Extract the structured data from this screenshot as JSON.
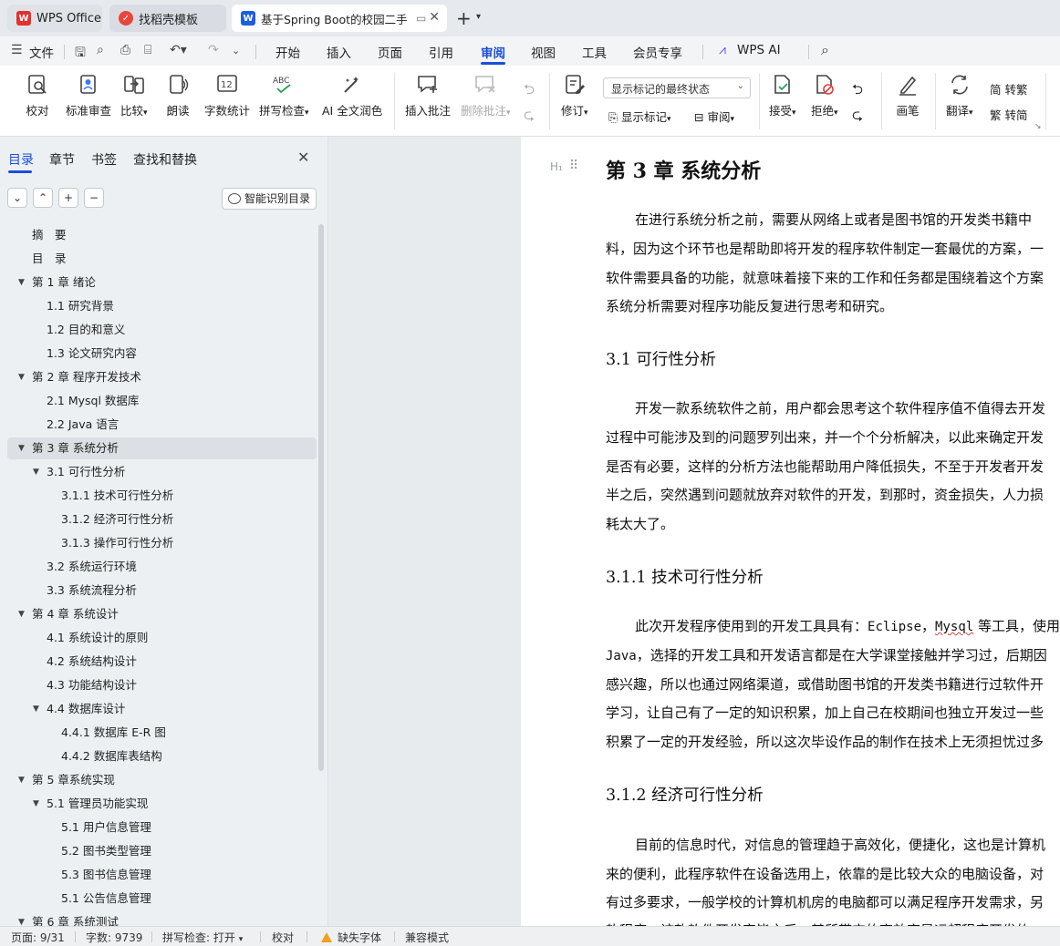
{
  "tabs": {
    "wps": "WPS Office",
    "template": "找稻壳模板",
    "document": "基于Spring Boot的校园二手"
  },
  "menu": {
    "file": "文件",
    "items": [
      "开始",
      "插入",
      "页面",
      "引用",
      "审阅",
      "视图",
      "工具",
      "会员专享"
    ],
    "active": "审阅",
    "wps_ai": "WPS AI"
  },
  "ribbon": {
    "proofread": "校对",
    "standard_review": "标准审查",
    "compare": "比较",
    "read_aloud": "朗读",
    "word_count": "字数统计",
    "spell_check": "拼写检查",
    "ai_polish": "AI 全文润色",
    "insert_comment": "插入批注",
    "delete_comment": "删除批注",
    "markup_select": "显示标记的最终状态",
    "track_changes": "修订",
    "show_markup": "显示标记",
    "review": "审阅",
    "accept": "接受",
    "reject": "拒绝",
    "pen": "画笔",
    "translate": "翻译",
    "to_traditional": "简 转繁",
    "to_simplified": "繁 转简"
  },
  "nav": {
    "tabs": [
      "目录",
      "章节",
      "书签",
      "查找和替换"
    ],
    "smart_detect": "智能识别目录",
    "toc": [
      {
        "label": "摘　要",
        "level": 0,
        "arrow": false
      },
      {
        "label": "目　录",
        "level": 0,
        "arrow": false
      },
      {
        "label": "第 1 章  绪论",
        "level": 0,
        "arrow": true
      },
      {
        "label": "1.1  研究背景",
        "level": 1,
        "arrow": false
      },
      {
        "label": "1.2 目的和意义",
        "level": 1,
        "arrow": false
      },
      {
        "label": "1.3  论文研究内容",
        "level": 1,
        "arrow": false
      },
      {
        "label": "第 2 章  程序开发技术",
        "level": 0,
        "arrow": true
      },
      {
        "label": "2.1 Mysql 数据库",
        "level": 1,
        "arrow": false
      },
      {
        "label": "2.2 Java 语言",
        "level": 1,
        "arrow": false
      },
      {
        "label": "第 3 章  系统分析",
        "level": 0,
        "arrow": true,
        "active": true
      },
      {
        "label": "3.1 可行性分析",
        "level": 1,
        "arrow": true
      },
      {
        "label": "3.1.1 技术可行性分析",
        "level": 2,
        "arrow": false
      },
      {
        "label": "3.1.2 经济可行性分析",
        "level": 2,
        "arrow": false
      },
      {
        "label": "3.1.3 操作可行性分析",
        "level": 2,
        "arrow": false
      },
      {
        "label": "3.2 系统运行环境",
        "level": 1,
        "arrow": false
      },
      {
        "label": "3.3 系统流程分析",
        "level": 1,
        "arrow": false
      },
      {
        "label": "第 4 章  系统设计",
        "level": 0,
        "arrow": true
      },
      {
        "label": "4.1  系统设计的原则",
        "level": 1,
        "arrow": false
      },
      {
        "label": "4.2  系统结构设计",
        "level": 1,
        "arrow": false
      },
      {
        "label": "4.3 功能结构设计",
        "level": 1,
        "arrow": false
      },
      {
        "label": "4.4 数据库设计",
        "level": 1,
        "arrow": true
      },
      {
        "label": "4.4.1  数据库 E-R 图",
        "level": 2,
        "arrow": false
      },
      {
        "label": "4.4.2  数据库表结构",
        "level": 2,
        "arrow": false
      },
      {
        "label": "第 5 章系统实现",
        "level": 0,
        "arrow": true
      },
      {
        "label": "5.1 管理员功能实现",
        "level": 1,
        "arrow": true
      },
      {
        "label": "5.1 用户信息管理",
        "level": 2,
        "arrow": false
      },
      {
        "label": "5.2  图书类型管理",
        "level": 2,
        "arrow": false
      },
      {
        "label": "5.3 图书信息管理",
        "level": 2,
        "arrow": false
      },
      {
        "label": "5.1 公告信息管理",
        "level": 2,
        "arrow": false
      },
      {
        "label": "第 6 章  系统测试",
        "level": 0,
        "arrow": true
      }
    ]
  },
  "doc": {
    "chapter_title": "第 3 章  系统分析",
    "intro": [
      "在进行系统分析之前，需要从网络上或者是图书馆的开发类书籍中",
      "料，因为这个环节也是帮助即将开发的程序软件制定一套最优的方案，一",
      "软件需要具备的功能，就意味着接下来的工作和任务都是围绕着这个方案",
      "系统分析需要对程序功能反复进行思考和研究。"
    ],
    "h_31": "3.1 可行性分析",
    "p_31": [
      "开发一款系统软件之前，用户都会思考这个软件程序值不值得去开发",
      "过程中可能涉及到的问题罗列出来，并一个个分析解决，以此来确定开发",
      "是否有必要，这样的分析方法也能帮助用户降低损失，不至于开发者开发",
      "半之后，突然遇到问题就放弃对软件的开发，到那时，资金损失，人力损",
      "耗太大了。"
    ],
    "h_311": "3.1.1 技术可行性分析",
    "p_311_first_a": "此次开发程序使用到的开发工具具有：",
    "p_311_eclipse": "Eclipse",
    "p_311_comma": "，",
    "p_311_mysql": "Mysql",
    "p_311_first_b": " 等工具，使用",
    "p_311_java": "Java",
    "p_311_second": "，选择的开发工具和开发语言都是在大学课堂接触并学习过，后期因",
    "p_311_rest": [
      "感兴趣，所以也通过网络渠道，或借助图书馆的开发类书籍进行过软件开",
      "学习，让自己有了一定的知识积累，加上自己在校期间也独立开发过一些",
      "积累了一定的开发经验，所以这次毕设作品的制作在技术上无须担忧过多"
    ],
    "h_312": "3.1.2 经济可行性分析",
    "p_312": [
      "目前的信息时代，对信息的管理趋于高效化，便捷化，这也是计算机",
      "来的便利，此程序软件在设备选用上，依靠的是比较大众的电脑设备，对",
      "有过多要求，一般学校的计算机机房的电脑都可以满足程序开发需求，另",
      "软程序，该款软件开发完毕之后，其所带来的高效率是远超程序开发的"
    ]
  },
  "status": {
    "page": "页面: 9/31",
    "words": "字数: 9739",
    "spell": "拼写检查: 打开",
    "proof": "校对",
    "missing_font": "缺失字体",
    "compat": "兼容模式"
  },
  "colors": {
    "accent": "#1a4fd8",
    "wps_red": "#e0312d",
    "warning": "#f0a020"
  }
}
